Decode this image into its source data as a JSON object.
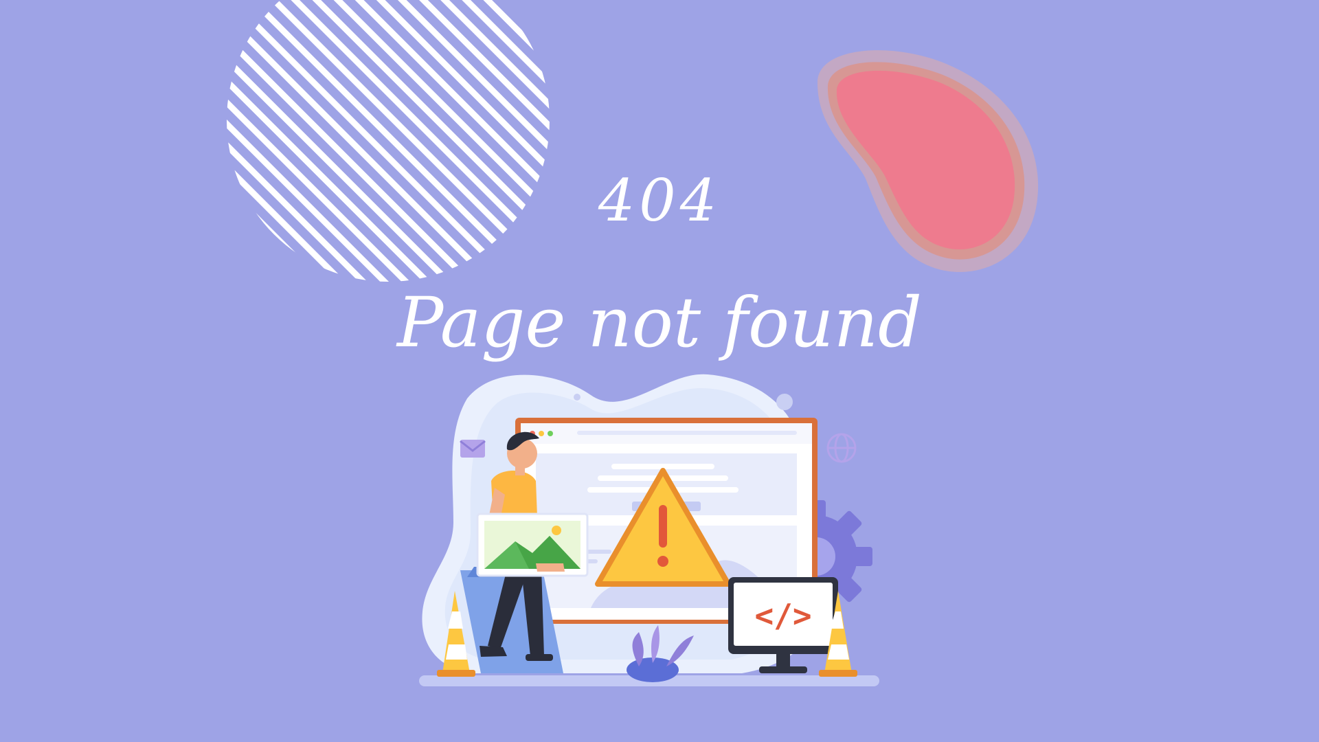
{
  "page": {
    "code": "404",
    "message": "Page not found"
  },
  "colors": {
    "background": "#9ea3e6",
    "blob_pink": "#ee7b8e",
    "text": "#ffffff",
    "warning_yellow": "#fdc741",
    "monitor_frame": "#d9703a",
    "code_brackets": "#e0593a"
  },
  "illustration": {
    "code_screen_label": "</>",
    "icons": [
      "striped-circle",
      "pink-blob",
      "browser-window",
      "warning-icon",
      "person",
      "picture-frame",
      "code-monitor",
      "gear-icon",
      "globe-icon",
      "mail-icon",
      "traffic-cone"
    ]
  }
}
